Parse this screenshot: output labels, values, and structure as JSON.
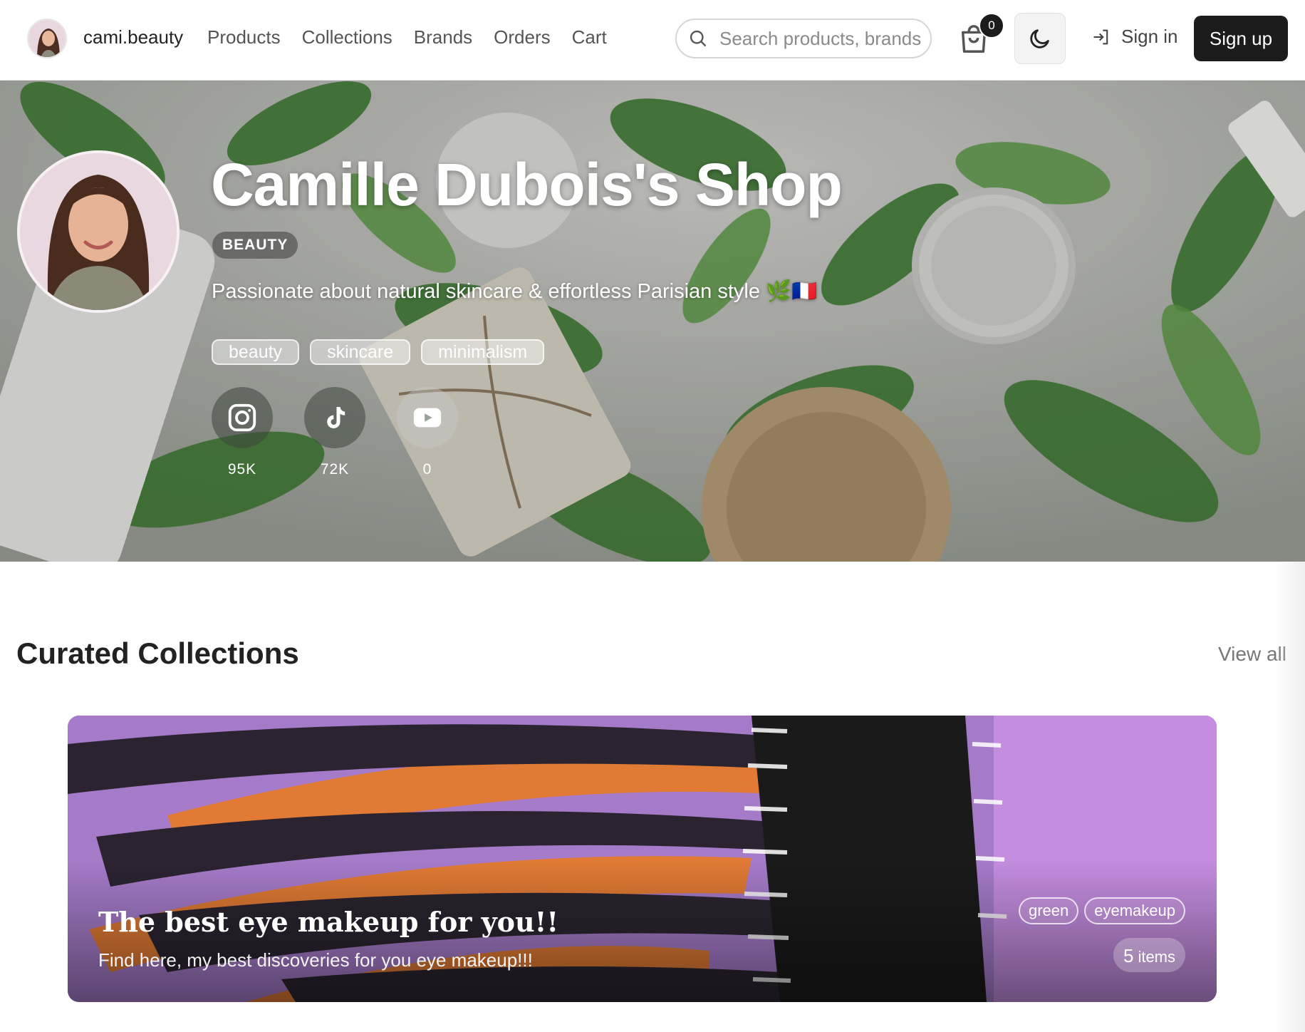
{
  "nav": {
    "brand": "cami.beauty",
    "links": [
      {
        "label": "Products"
      },
      {
        "label": "Collections"
      },
      {
        "label": "Brands"
      },
      {
        "label": "Orders"
      },
      {
        "label": "Cart"
      }
    ],
    "search_placeholder": "Search products, brands",
    "cart_count": "0",
    "sign_in": "Sign in",
    "sign_up": "Sign up"
  },
  "hero": {
    "title": "Camille Dubois's Shop",
    "category": "BEAUTY",
    "bio": "Passionate about natural skincare & effortless Parisian style 🌿🇫🇷",
    "tags": [
      "beauty",
      "skincare",
      "minimalism"
    ],
    "socials": [
      {
        "icon": "instagram-icon",
        "count": "95K"
      },
      {
        "icon": "tiktok-icon",
        "count": "72K"
      },
      {
        "icon": "youtube-icon",
        "count": "0"
      }
    ]
  },
  "collections": {
    "title": "Curated Collections",
    "view_all": "View all",
    "items": [
      {
        "title": "The best eye makeup for you!!",
        "description": "Find here, my best discoveries for you eye makeup!!!",
        "tags": [
          "green",
          "eyemakeup"
        ],
        "item_count": "5",
        "item_label": "items"
      }
    ]
  },
  "colors": {
    "primary": "#1c1c1c",
    "card_accent": "#a77bd0"
  }
}
